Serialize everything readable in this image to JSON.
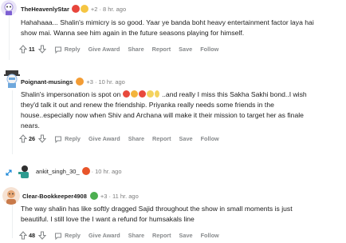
{
  "comments": [
    {
      "author": "TheHeavenlyStar",
      "karma": "+2",
      "time": "8 hr. ago",
      "lines": [
        "Hahahaaa... Shalin's mimicry is so good. Yaar ye banda boht heavy entertainment factor laya hai",
        "show mai. Wanna see him again in the future seasons playing for himself."
      ],
      "votes": "11"
    },
    {
      "author": "Poignant-musings",
      "karma": "+3",
      "time": "10 hr. ago",
      "line1_prefix": "Shalin's impersonation is spot on",
      "line1_suffix": "..and really I miss this Sakha Sakhi bond..I wish",
      "lines": [
        "they'd talk it out and renew the friendship. Priyanka really needs some friends in the",
        "house..especially now when Shiv and Archana will make it their mission to target her as finale",
        "nears."
      ],
      "votes": "26"
    },
    {
      "author": "ankit_singh_30_",
      "time": "10 hr. ago"
    },
    {
      "author": "Clear-Bookkeeper4908",
      "karma": "+3",
      "time": "11 hr. ago",
      "lines": [
        "The way shalin has like softly dragged Sajid throughout the show in small moments is just",
        "beautiful. I still love the I want a refund for humsakals line"
      ],
      "votes": "48"
    }
  ],
  "actions": {
    "reply": "Reply",
    "give_award": "Give Award",
    "share": "Share",
    "report": "Report",
    "save": "Save",
    "follow": "Follow"
  },
  "colors": {
    "meta_gray": "#7c7c7c",
    "action_gray": "#878a8c",
    "text": "#1c1c1c",
    "thread_line": "#edeff1"
  }
}
